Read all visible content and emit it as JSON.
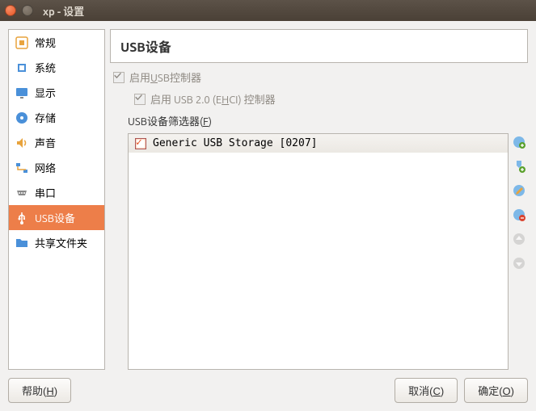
{
  "window": {
    "title": "xp - 设置"
  },
  "sidebar": {
    "items": [
      {
        "label": "常规"
      },
      {
        "label": "系统"
      },
      {
        "label": "显示"
      },
      {
        "label": "存储"
      },
      {
        "label": "声音"
      },
      {
        "label": "网络"
      },
      {
        "label": "串口"
      },
      {
        "label": "USB设备"
      },
      {
        "label": "共享文件夹"
      }
    ]
  },
  "panel": {
    "title": "USB设备",
    "enable_prefix": "启用",
    "enable_u": "U",
    "enable_suffix": "SB控制器",
    "enable20_prefix": "启用 USB 2.0 (E",
    "enable20_u": "H",
    "enable20_suffix": "CI) 控制器",
    "filter_label_prefix": "USB设备筛选器(",
    "filter_label_u": "F",
    "filter_label_suffix": ")",
    "filters": [
      {
        "label": "Generic USB Storage [0207]"
      }
    ]
  },
  "footer": {
    "help_prefix": "帮助(",
    "help_u": "H",
    "help_suffix": ")",
    "cancel_prefix": "取消(",
    "cancel_u": "C",
    "cancel_suffix": ")",
    "ok_prefix": "确定(",
    "ok_u": "O",
    "ok_suffix": ")"
  }
}
